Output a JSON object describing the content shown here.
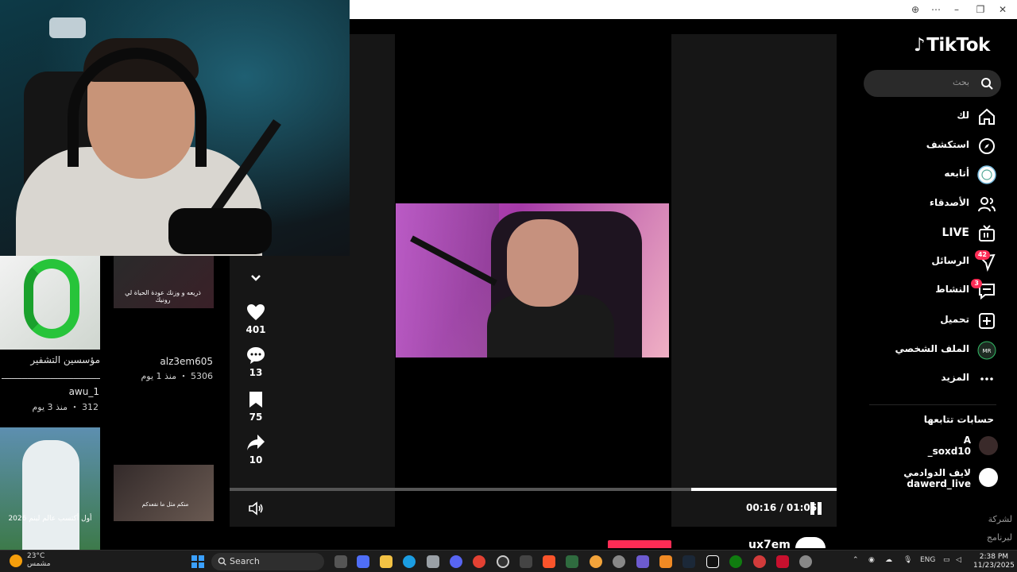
{
  "browser": {
    "zoom_icon": "zoom-icon",
    "more_icon": "more-icon"
  },
  "tiktok": {
    "logo": "TikTok",
    "search_placeholder": "بحث",
    "nav": [
      {
        "label": "لك",
        "icon": "home-icon"
      },
      {
        "label": "استكشف",
        "icon": "compass-icon"
      },
      {
        "label": "أتابعه",
        "icon": "following-avatar-icon"
      },
      {
        "label": "الأصدقاء",
        "icon": "friends-icon"
      },
      {
        "label": "LIVE",
        "icon": "live-tv-icon"
      },
      {
        "label": "الرسائل",
        "icon": "messages-icon",
        "badge": "42"
      },
      {
        "label": "النشاط",
        "icon": "activity-icon",
        "badge": "3"
      },
      {
        "label": "تحميل",
        "icon": "upload-icon"
      },
      {
        "label": "الملف الشخصي",
        "icon": "profile-avatar-icon"
      },
      {
        "label": "المزيد",
        "icon": "more-dots-icon"
      }
    ],
    "following_header": "حسابات تتابعها",
    "following": [
      {
        "name": "A",
        "handle": "_soxd10"
      },
      {
        "name": "لايف الدوادمي",
        "handle": "dawerd_live"
      }
    ],
    "footer": [
      "لشركة",
      "لبرنامج"
    ]
  },
  "player": {
    "likes": "401",
    "comments": "13",
    "saves": "75",
    "shares": "10",
    "time": "00:16 / 01:06",
    "progress": 0.24,
    "creator_handle": "ux7em"
  },
  "thumbs": {
    "t1_title": "مؤسسين التشفير",
    "t1_sub": "ـــــــــــــــــــــــــــــــــــــــــــــ",
    "t1_user": "awu_1",
    "t1_stats": "312 ・ منذ 3 يوم",
    "t2_caption": "ذريعه و وزنك عودة الحياة لي رونيك",
    "t2_user": "alz3em605",
    "t2_stats": "5306 ・ منذ 1 يوم",
    "t3_caption": "أول أكتسب عالم لبنم 2026",
    "t4_caption": "منكم مثل ما نقعدكم"
  },
  "taskbar": {
    "temp": "23°C",
    "weather": "مشمس",
    "search": "Search",
    "lang": "ENG",
    "time": "2:38 PM",
    "date": "11/23/2025"
  },
  "colors": {
    "accent": "#fe2c55",
    "coin": "#27c43a"
  }
}
